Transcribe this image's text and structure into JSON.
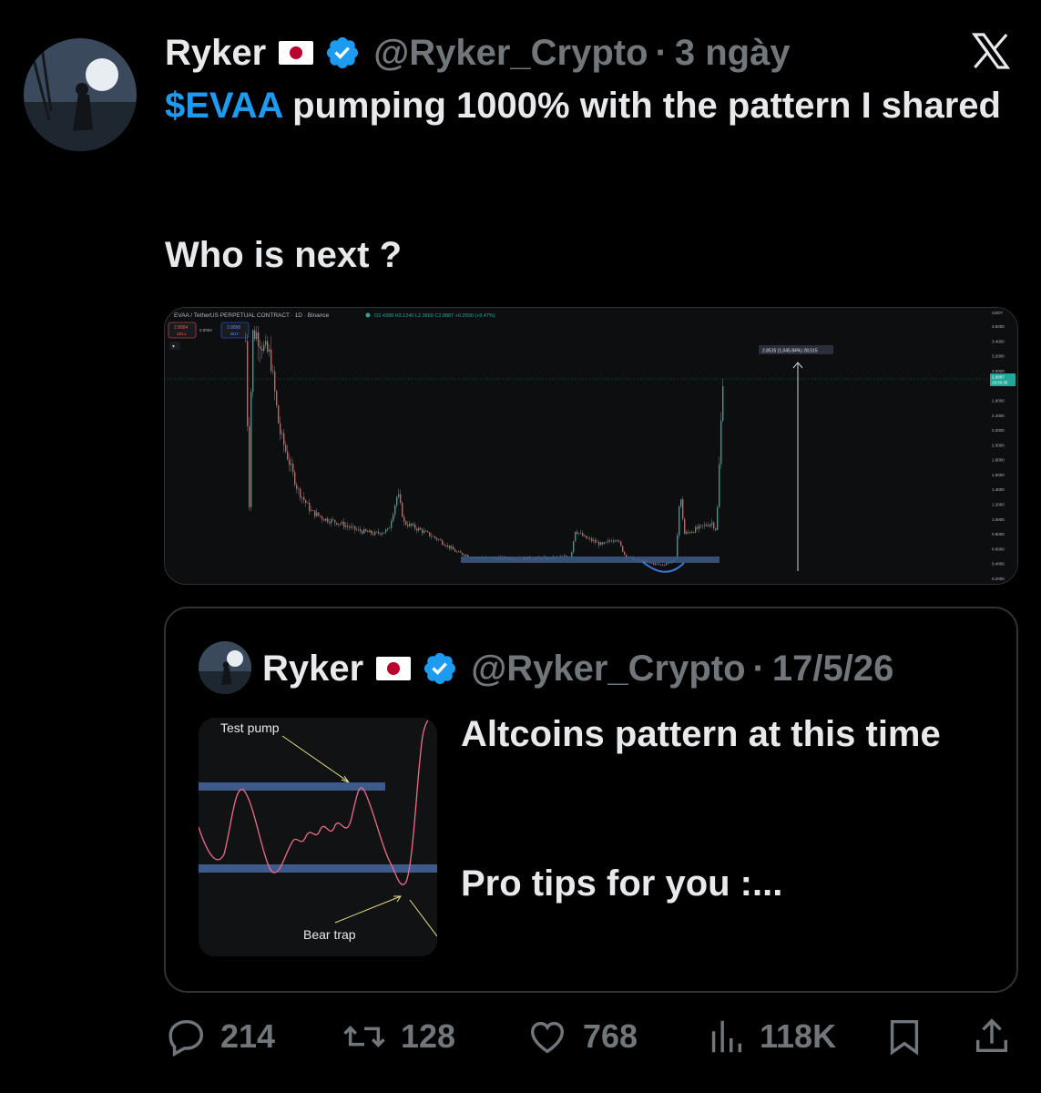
{
  "tweet": {
    "author_name": "Ryker",
    "handle": "@Ryker_Crypto",
    "separator": "·",
    "time": "3 ngày",
    "cashtag": "$EVAA",
    "text_after_cashtag": "pumping 1000% with the pattern I shared",
    "text_line2": "Who is next ?"
  },
  "chart_image": {
    "header": "EVAA / TetherUS PERPETUAL CONTRACT · 1D · Binance",
    "ohlc": "O2.4388 H3.1240 L2.3669 C2.8887 +0.2500 (+9.47%)",
    "sell_price": "2.8884",
    "sell_label": "SELL",
    "spread": "0.0004",
    "buy_price": "2.8890",
    "buy_label": "BUY",
    "currency": "USDT",
    "price_ticks": [
      "3.6000",
      "3.4000",
      "3.2000",
      "3.0000",
      "2.6000",
      "2.4000",
      "2.2000",
      "2.0000",
      "1.8000",
      "1.6000",
      "1.4000",
      "1.2000",
      "1.0000",
      "0.8000",
      "0.6000",
      "0.4000",
      "0.2000"
    ],
    "current_price": "2.8887",
    "countdown": "18:56:36",
    "measure_label": "2.8515 (1,045.84%) 28,515"
  },
  "quoted_tweet": {
    "author_name": "Ryker",
    "handle": "@Ryker_Crypto",
    "separator": "·",
    "date": "17/5/26",
    "text": "Altcoins pattern at this time",
    "text2": "Pro tips for you :...",
    "thumb_label_top": "Test pump",
    "thumb_label_bottom": "Bear trap"
  },
  "actions": {
    "replies": "214",
    "reposts": "128",
    "likes": "768",
    "views": "118K"
  },
  "colors": {
    "accent": "#1d9bf0",
    "muted": "#71767b",
    "card_border": "#2f3336",
    "candle_up": "#26a69a",
    "candle_down": "#ef5350",
    "support_band": "#3d5a8a"
  },
  "icons": [
    "x-logo-icon",
    "verified-badge-icon",
    "reply-icon",
    "repost-icon",
    "like-icon",
    "views-icon",
    "bookmark-icon",
    "share-icon"
  ]
}
